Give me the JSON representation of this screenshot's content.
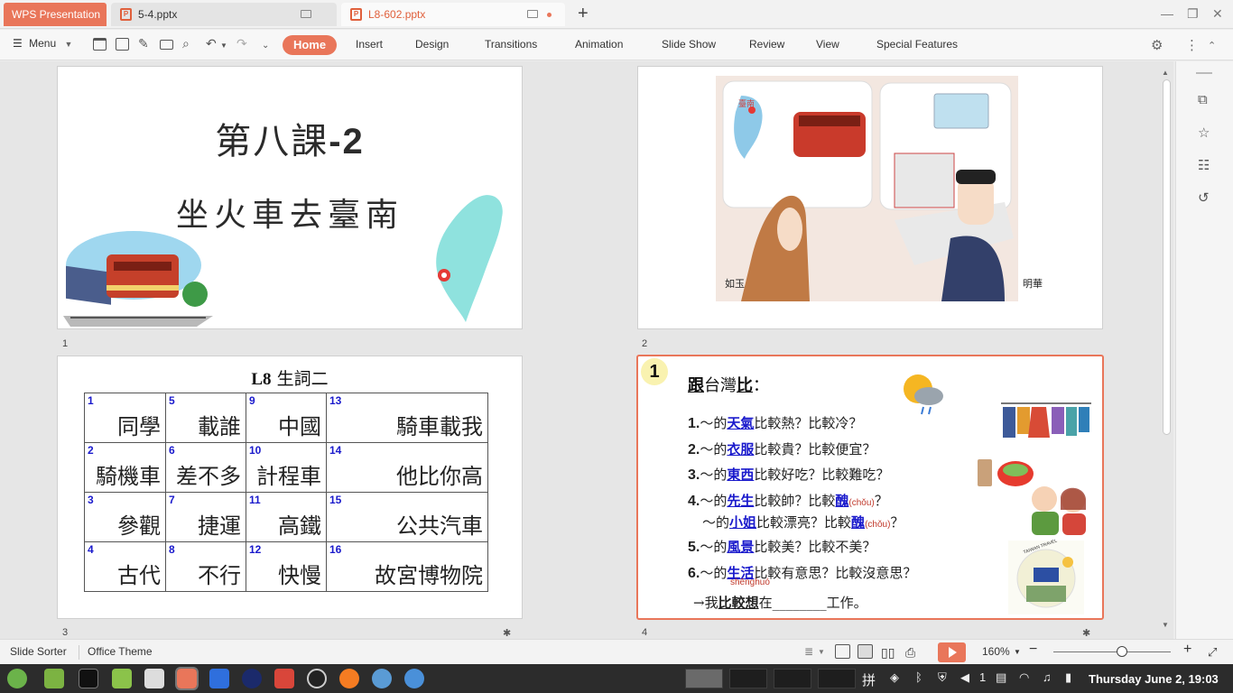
{
  "window": {
    "app_tab": "WPS Presentation",
    "tabs": [
      {
        "label": "5-4.pptx"
      },
      {
        "label": "L8-602.pptx"
      }
    ]
  },
  "toolbar": {
    "menu_label": "Menu",
    "ribbon_tabs": [
      "Home",
      "Insert",
      "Design",
      "Transitions",
      "Animation",
      "Slide Show",
      "Review",
      "View",
      "Special Features"
    ]
  },
  "slides": [
    {
      "number": "1",
      "title_line1": "第八課",
      "title_line1_suffix": "-2",
      "title_line2": "坐火車去臺南"
    },
    {
      "number": "2",
      "left_name": "如玉",
      "right_name": "明華",
      "map_label": "臺南"
    },
    {
      "number": "3",
      "title_code": "L8",
      "title_text": " 生詞二",
      "rows": [
        [
          {
            "n": "1",
            "w": "同學"
          },
          {
            "n": "5",
            "w": "載誰"
          },
          {
            "n": "9",
            "w": "中國"
          },
          {
            "n": "13",
            "w": "騎車載我"
          }
        ],
        [
          {
            "n": "2",
            "w": "騎機車"
          },
          {
            "n": "6",
            "w": "差不多"
          },
          {
            "n": "10",
            "w": "計程車"
          },
          {
            "n": "14",
            "w": "他比你高"
          }
        ],
        [
          {
            "n": "3",
            "w": "參觀"
          },
          {
            "n": "7",
            "w": "捷運"
          },
          {
            "n": "11",
            "w": "高鐵"
          },
          {
            "n": "15",
            "w": "公共汽車"
          }
        ],
        [
          {
            "n": "4",
            "w": "古代"
          },
          {
            "n": "8",
            "w": "不行"
          },
          {
            "n": "12",
            "w": "快慢"
          },
          {
            "n": "16",
            "w": "故宮博物院"
          }
        ]
      ]
    },
    {
      "number": "4",
      "badge": "1",
      "heading_a": "跟",
      "heading_b": "台灣",
      "heading_c": "比",
      "heading_d": "：",
      "questions": [
        {
          "num": "1.",
          "pre": "～的",
          "kw": "天氣",
          "post": "比較熱？比較冷？"
        },
        {
          "num": "2.",
          "pre": "～的",
          "kw": "衣服",
          "post": "比較貴？比較便宜？"
        },
        {
          "num": "3.",
          "pre": "～的",
          "kw": "東西",
          "post": "比較好吃？比較難吃？"
        }
      ],
      "q4": {
        "num": "4.",
        "pre": "～的",
        "kw": "先生",
        "mid": "比較帥？比較",
        "kw2": "醜",
        "py": "(chǒu)",
        "end": "？"
      },
      "q4b": {
        "pre": "～的",
        "kw": "小姐",
        "mid": "比較漂亮？比較",
        "kw2": "醜",
        "py": "(chǒu)",
        "end": "？"
      },
      "q5": {
        "num": "5.",
        "pre": "～的",
        "kw": "風景",
        "post": "比較美？比較不美？"
      },
      "q6": {
        "num": "6.",
        "pre": "～的",
        "kw": "生活",
        "post": "比較有意思？比較沒意思？",
        "pinyin": "shēnghuó"
      },
      "last": {
        "arrow": "→我",
        "bold": "比較想",
        "post": "在________工作。"
      },
      "sticker_text": "TAIWAN TRAVEL"
    }
  ],
  "status": {
    "left_items": [
      "Slide Sorter",
      "Office Theme"
    ],
    "zoom": "160%"
  },
  "taskbar": {
    "pinned_count": "1",
    "clock": "Thursday June  2, 19:03"
  },
  "colors": {
    "accent": "#e9765a",
    "keyword_blue": "#1a1acc",
    "pinyin_red": "#c0392b"
  }
}
